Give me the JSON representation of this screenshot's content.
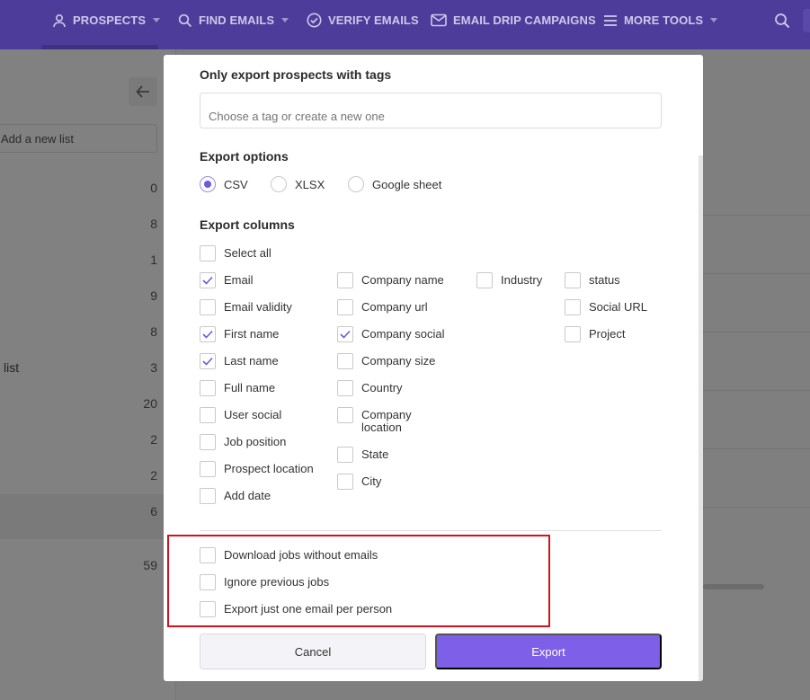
{
  "nav": {
    "items": [
      {
        "label": "PROSPECTS",
        "icon": "user-icon",
        "dropdown": true
      },
      {
        "label": "FIND EMAILS",
        "icon": "search-icon",
        "dropdown": true
      },
      {
        "label": "VERIFY EMAILS",
        "icon": "check-circle-icon",
        "dropdown": false
      },
      {
        "label": "EMAIL DRIP CAMPAIGNS",
        "icon": "envelope-icon",
        "dropdown": false
      },
      {
        "label": "MORE TOOLS",
        "icon": "menu-icon",
        "dropdown": true
      }
    ],
    "search_icon": "search-icon"
  },
  "background": {
    "add_list_placeholder": "Add a new list",
    "list_counts": [
      "0",
      "8",
      "1",
      "9",
      "8",
      "3",
      "20",
      "2",
      "2",
      "6",
      "59"
    ],
    "list_label": "list"
  },
  "modal": {
    "tags": {
      "title": "Only export prospects with tags",
      "placeholder": "Choose a tag or create a new one"
    },
    "export_options": {
      "title": "Export options",
      "options": [
        "CSV",
        "XLSX",
        "Google sheet"
      ],
      "selected": "CSV"
    },
    "export_columns": {
      "title": "Export columns",
      "select_all": "Select all",
      "column1": [
        {
          "label": "Email",
          "checked": true
        },
        {
          "label": "Email validity",
          "checked": false
        },
        {
          "label": "First name",
          "checked": true
        },
        {
          "label": "Last name",
          "checked": true
        },
        {
          "label": "Full name",
          "checked": false
        },
        {
          "label": "User social",
          "checked": false
        },
        {
          "label": "Job position",
          "checked": false
        },
        {
          "label": "Prospect location",
          "checked": false
        },
        {
          "label": "Add date",
          "checked": false
        }
      ],
      "column2": [
        {
          "label": "Company name",
          "checked": false
        },
        {
          "label": "Company url",
          "checked": false
        },
        {
          "label": "Company social",
          "checked": true
        },
        {
          "label": "Company size",
          "checked": false
        },
        {
          "label": "Country",
          "checked": false
        },
        {
          "label": "Company location",
          "checked": false
        },
        {
          "label": "State",
          "checked": false
        },
        {
          "label": "City",
          "checked": false
        }
      ],
      "column3": [
        {
          "label": "Industry",
          "checked": false
        }
      ],
      "column4": [
        {
          "label": "status",
          "checked": false
        },
        {
          "label": "Social URL",
          "checked": false
        },
        {
          "label": "Project",
          "checked": false
        }
      ]
    },
    "extra_options": [
      {
        "label": "Download jobs without emails",
        "checked": false
      },
      {
        "label": "Ignore previous jobs",
        "checked": false
      },
      {
        "label": "Export just one email per person",
        "checked": false
      }
    ],
    "cancel_label": "Cancel",
    "export_label": "Export"
  },
  "colors": {
    "brand": "#4e3c9a",
    "accent": "#7e5fe8",
    "highlight": "#d4121e"
  }
}
